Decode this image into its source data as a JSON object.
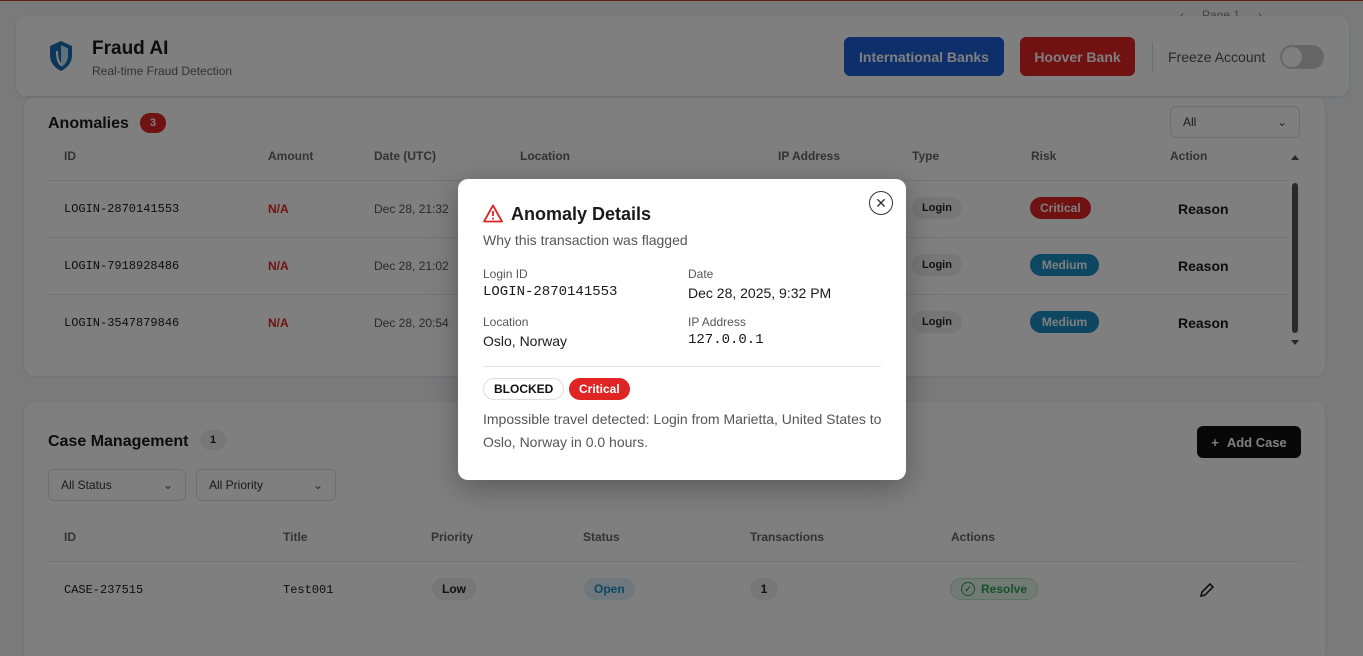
{
  "pager": {
    "text": "Page 1",
    "prev": "‹",
    "next": "›"
  },
  "header": {
    "title": "Fraud AI",
    "subtitle": "Real-time Fraud Detection",
    "intl_button": "International Banks",
    "hoover_button": "Hoover Bank",
    "freeze_label": "Freeze Account",
    "freeze_on": false
  },
  "anomalies": {
    "title": "Anomalies",
    "count": "3",
    "filter": "All",
    "columns": [
      "ID",
      "Amount",
      "Date (UTC)",
      "Location",
      "IP Address",
      "Type",
      "Risk",
      "Action"
    ],
    "rows": [
      {
        "id": "LOGIN-2870141553",
        "amount": "N/A",
        "date": "Dec 28, 21:32",
        "type": "Login",
        "risk": "Critical",
        "action": "Reason"
      },
      {
        "id": "LOGIN-7918928486",
        "amount": "N/A",
        "date": "Dec 28, 21:02",
        "type": "Login",
        "risk": "Medium",
        "action": "Reason"
      },
      {
        "id": "LOGIN-3547879846",
        "amount": "N/A",
        "date": "Dec 28, 20:54",
        "type": "Login",
        "risk": "Medium",
        "action": "Reason"
      }
    ]
  },
  "cases": {
    "title": "Case Management",
    "count": "1",
    "status_filter": "All Status",
    "priority_filter": "All Priority",
    "add_button": "Add Case",
    "columns": [
      "ID",
      "Title",
      "Priority",
      "Status",
      "Transactions",
      "Actions"
    ],
    "rows": [
      {
        "id": "CASE-237515",
        "title": "Test001",
        "priority": "Low",
        "status": "Open",
        "transactions": "1",
        "resolve": "Resolve"
      }
    ]
  },
  "modal": {
    "title": "Anomaly Details",
    "subtitle": "Why this transaction was flagged",
    "login_id_label": "Login ID",
    "login_id": "LOGIN-2870141553",
    "date_label": "Date",
    "date": "Dec 28, 2025, 9:32 PM",
    "location_label": "Location",
    "location": "Oslo, Norway",
    "ip_label": "IP Address",
    "ip": "127.0.0.1",
    "status_badge": "BLOCKED",
    "risk_badge": "Critical",
    "reason": "Impossible travel detected: Login from Marietta, United States to Oslo, Norway in 0.0 hours."
  },
  "colors": {
    "critical": "#e02424",
    "medium": "#1b8fc4",
    "primary_blue": "#1e5fd6",
    "na_red": "#e02424"
  }
}
